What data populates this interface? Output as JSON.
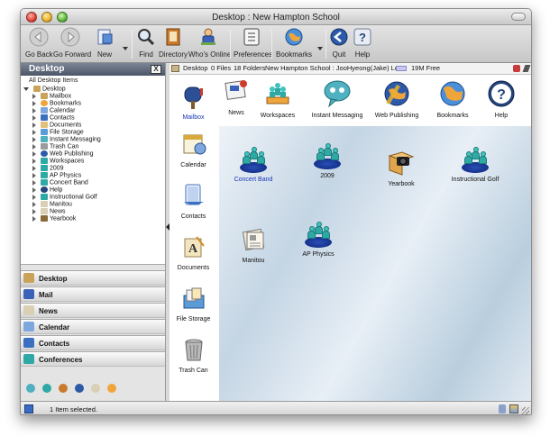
{
  "window": {
    "title": "Desktop : New Hampton School"
  },
  "toolbar": {
    "go_back": "Go Back",
    "go_forward": "Go Forward",
    "new": "New",
    "find": "Find",
    "directory": "Directory",
    "whos_online": "Who's Online",
    "preferences": "Preferences",
    "bookmarks": "Bookmarks",
    "quit": "Quit",
    "help": "Help"
  },
  "sidebar": {
    "title": "Desktop",
    "close_label": "X",
    "tree_heading": "All Desktop Items",
    "root": "Desktop",
    "items": [
      "Mailbox",
      "Bookmarks",
      "Calendar",
      "Contacts",
      "Documents",
      "File Storage",
      "Instant Messaging",
      "Trash Can",
      "Web Publishing",
      "Workspaces",
      "2009",
      "AP Physics",
      "Concert Band",
      "Help",
      "Instructional Golf",
      "Manitou",
      "News",
      "Yearbook"
    ],
    "nav": [
      "Desktop",
      "Mail",
      "News",
      "Calendar",
      "Contacts",
      "Conferences"
    ]
  },
  "pathbar": {
    "location": "Desktop",
    "files": "0 Files",
    "folders": "18 Folders",
    "user": "New Hampton School : JooHyeong(Jake) Lee",
    "free": "19M Free"
  },
  "apps_column": [
    "Mailbox",
    "Calendar",
    "Contacts",
    "Documents",
    "File Storage",
    "Trash Can"
  ],
  "apps_top": [
    "News",
    "Workspaces",
    "Instant Messaging",
    "Web Publishing",
    "Bookmarks",
    "Help"
  ],
  "desktop_items": [
    "Concert Band",
    "2009",
    "Yearbook",
    "Instructional Golf",
    "Manitou",
    "AP Physics"
  ],
  "status": {
    "text": "1 Item selected."
  },
  "colors": {
    "selected_label": "#1a35b8",
    "sidebar_header": "#4d5668",
    "group_base": "#0c247a",
    "person": "#2fa9a5"
  }
}
